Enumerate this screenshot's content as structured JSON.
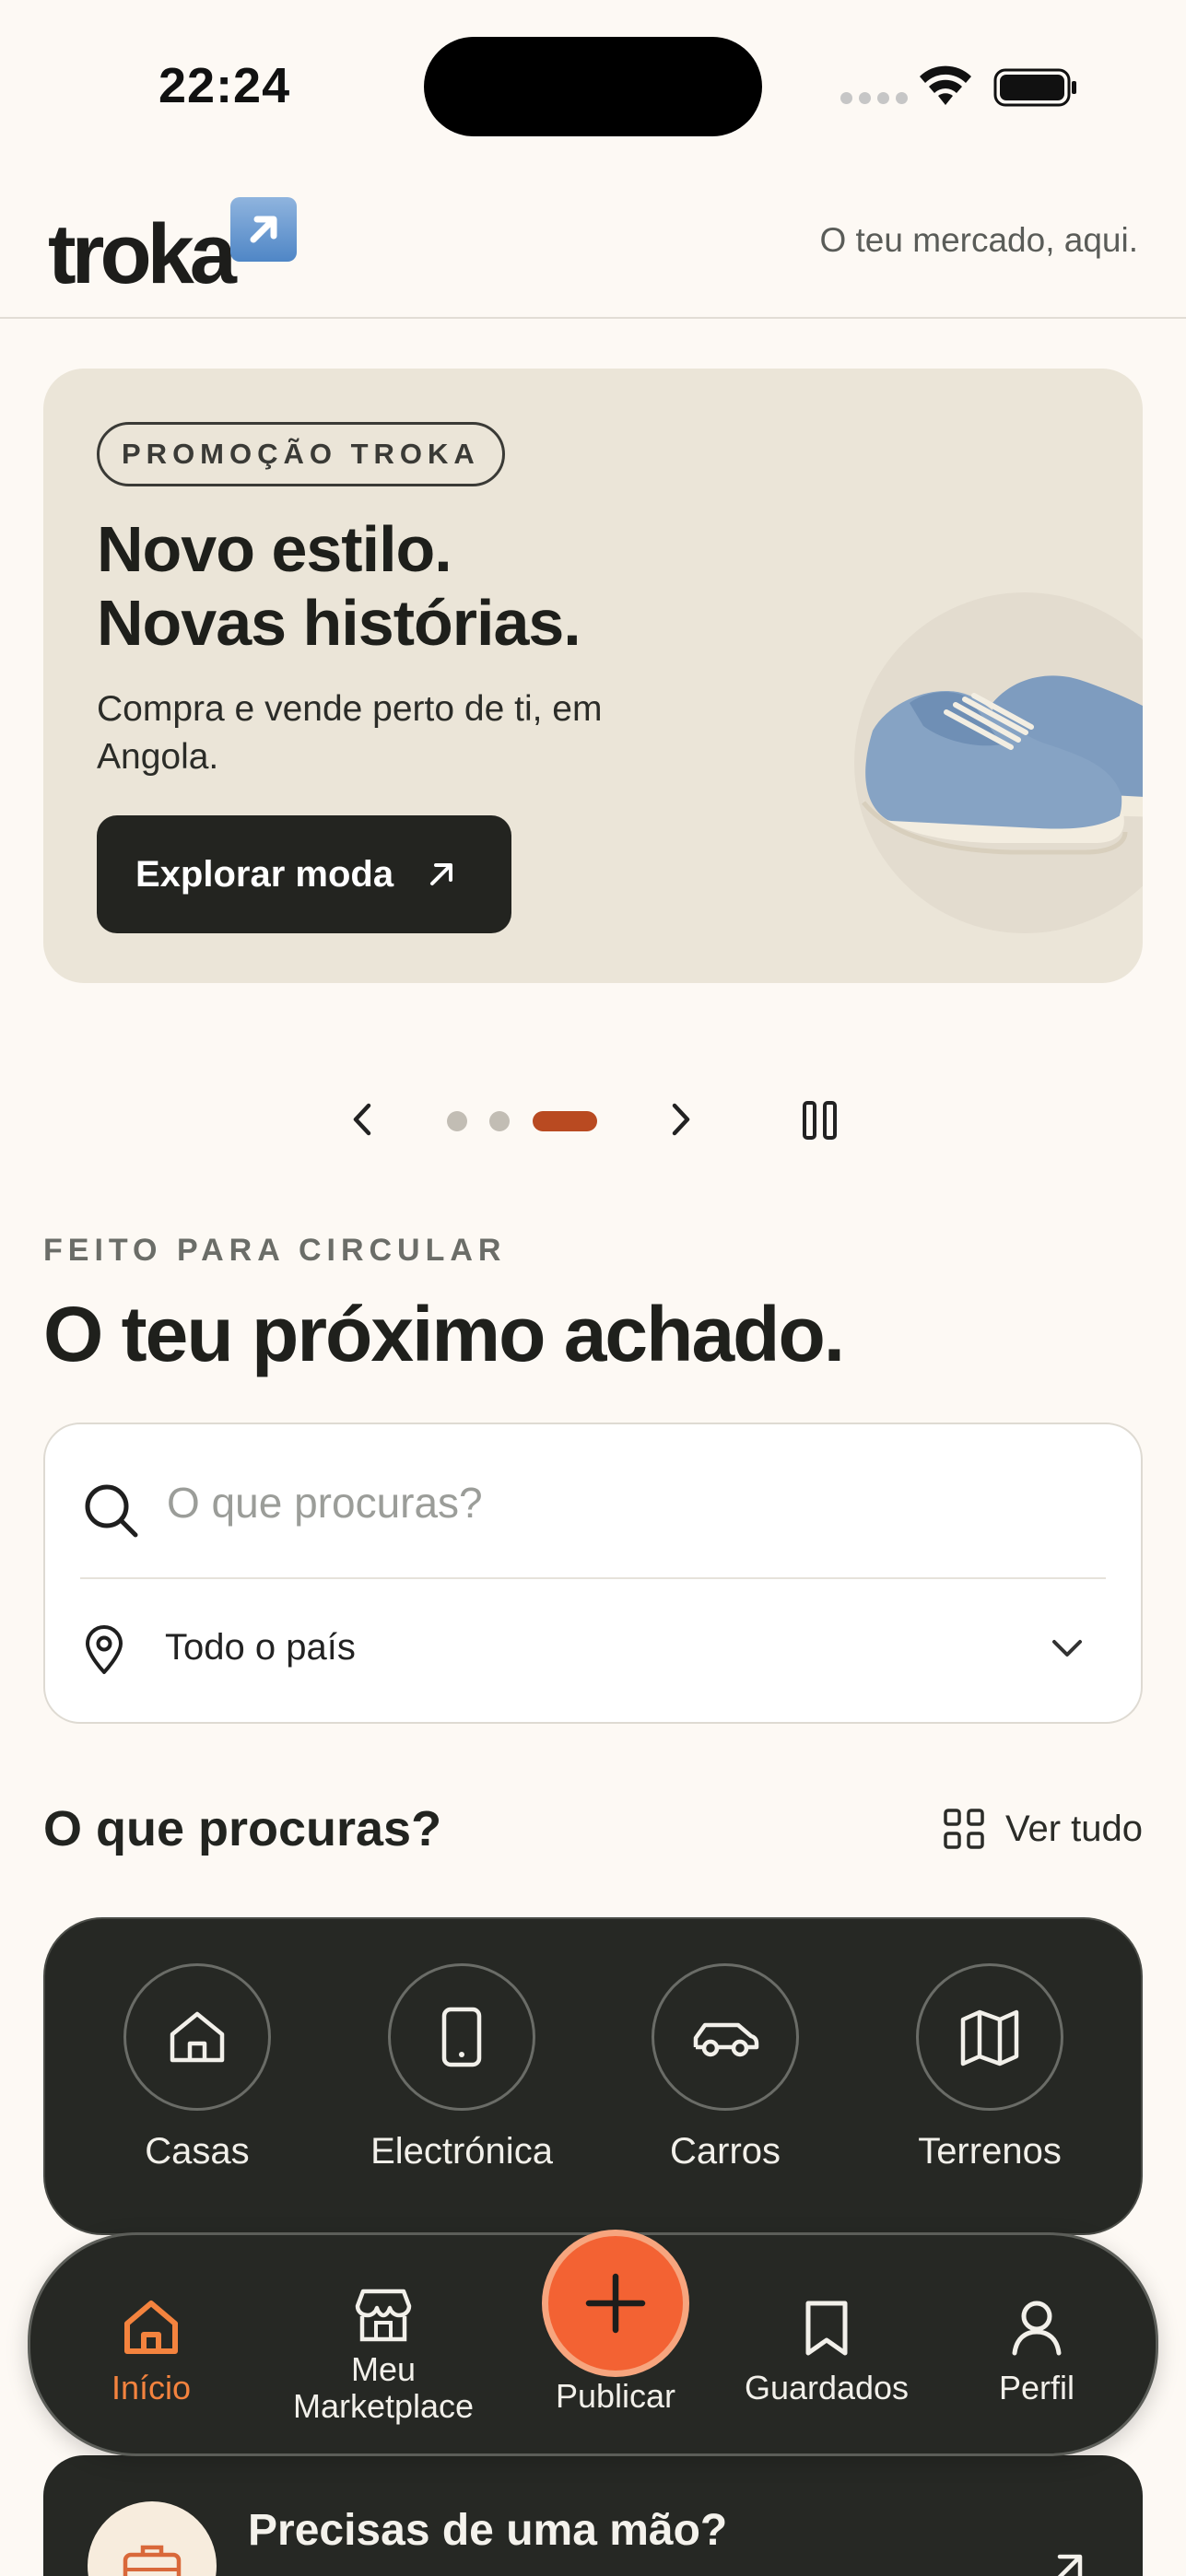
{
  "status_bar": {
    "time": "22:24"
  },
  "header": {
    "logo_text": "troka",
    "tagline": "O teu mercado, aqui."
  },
  "promo": {
    "badge": "PROMOÇÃO TROKA",
    "title_line1": "Novo estilo.",
    "title_line2": "Novas histórias.",
    "subtitle": "Compra e vende perto de ti, em Angola.",
    "cta_label": "Explorar moda"
  },
  "carousel": {
    "slide_count": 3,
    "active_index": 2
  },
  "section": {
    "eyebrow": "FEITO PARA CIRCULAR",
    "headline": "O teu próximo achado."
  },
  "search": {
    "placeholder": "O que procuras?",
    "value": "",
    "location": "Todo o país"
  },
  "categories": {
    "title": "O que procuras?",
    "see_all": "Ver tudo",
    "items": [
      {
        "label": "Casas",
        "icon": "house-icon"
      },
      {
        "label": "Electrónica",
        "icon": "phone-icon"
      },
      {
        "label": "Carros",
        "icon": "car-icon"
      },
      {
        "label": "Terrenos",
        "icon": "map-icon"
      }
    ]
  },
  "nav": {
    "items": [
      {
        "label": "Início",
        "icon": "home-icon",
        "active": true
      },
      {
        "label": "Meu\nMarketplace",
        "icon": "store-icon",
        "active": false
      },
      {
        "label": "Publicar",
        "icon": "plus-icon",
        "active": false
      },
      {
        "label": "Guardados",
        "icon": "bookmark-icon",
        "active": false
      },
      {
        "label": "Perfil",
        "icon": "user-icon",
        "active": false
      }
    ]
  },
  "help": {
    "title": "Precisas de uma mão?"
  },
  "colors": {
    "accent": "#f36233",
    "active_dot": "#b94a21",
    "dark_panel": "#262824",
    "background": "#fdf9f4"
  }
}
